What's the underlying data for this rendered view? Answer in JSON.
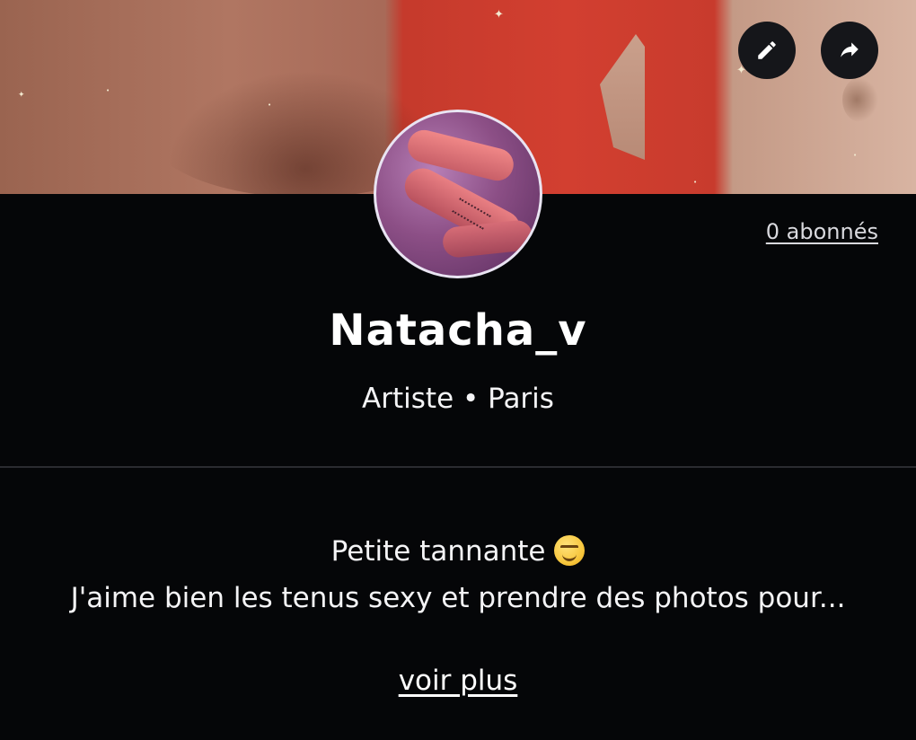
{
  "cover": {
    "edit_icon": "pencil-icon",
    "share_icon": "share-arrow-icon"
  },
  "profile": {
    "followers_label": "0 abonnés",
    "username": "Natacha_v",
    "meta": "Artiste • Paris"
  },
  "bio": {
    "line1": "Petite tannante",
    "line1_emoji": "smirking-face-emoji",
    "line2": "J'aime bien les tenus sexy et prendre des photos pour...",
    "more_label": "voir plus"
  },
  "colors": {
    "background": "#050608",
    "text": "#ffffff",
    "divider": "#2a2b30",
    "button_bg": "#15161a"
  }
}
